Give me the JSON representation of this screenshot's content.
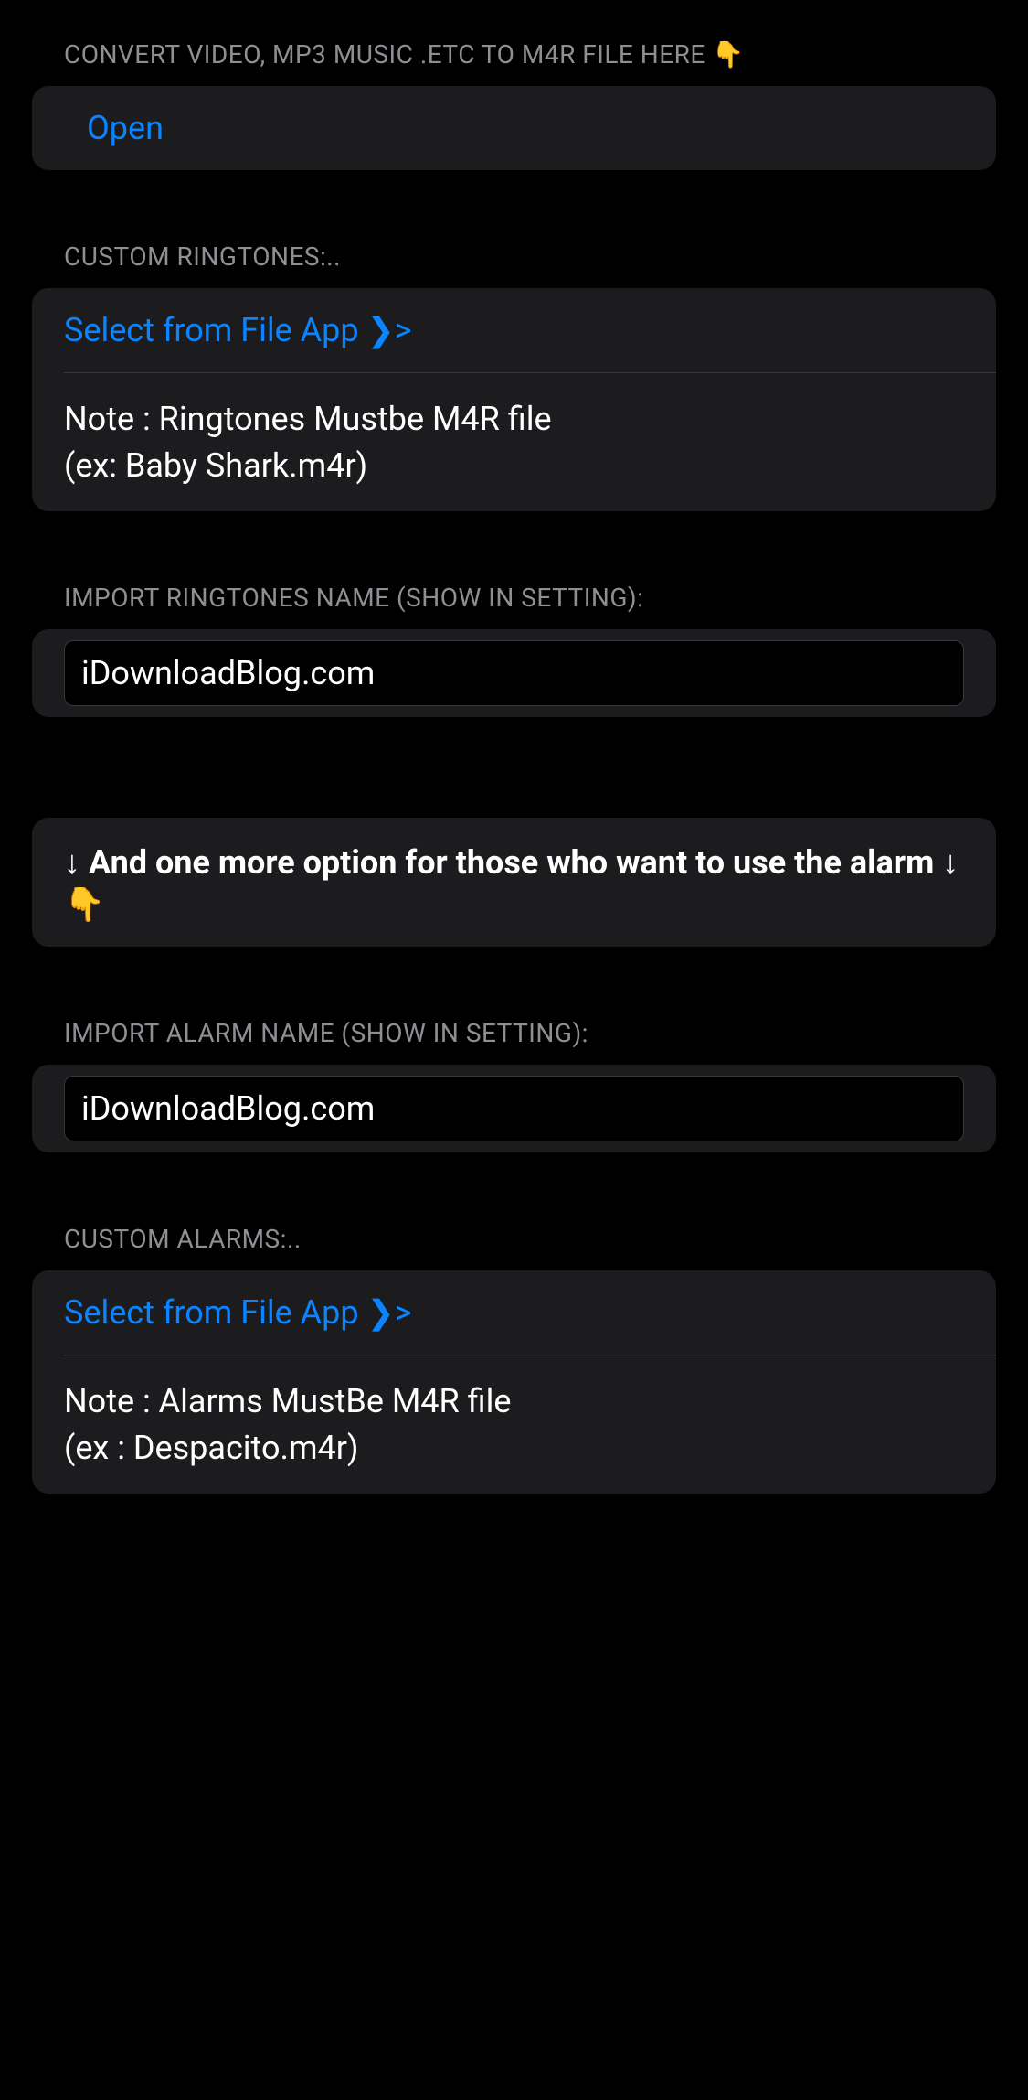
{
  "sections": {
    "convert": {
      "header": "CONVERT VIDEO, MP3 MUSIC .ETC TO M4R FILE HERE  👇",
      "open_label": "Open"
    },
    "custom_ringtones": {
      "header": "CUSTOM RINGTONES:..",
      "select_label": "Select from File App ❯>",
      "note_line1": "Note : Ringtones Mustbe M4R file",
      "note_line2": "(ex: Baby Shark.m4r)"
    },
    "import_ringtone_name": {
      "header": "IMPORT RINGTONES NAME (SHOW IN SETTING):",
      "value": "iDownloadBlog.com"
    },
    "alarm_info": {
      "text": "↓ And one more option for those who want to use the alarm ↓",
      "emoji": "👇"
    },
    "import_alarm_name": {
      "header": "IMPORT ALARM NAME (SHOW IN SETTING):",
      "value": "iDownloadBlog.com"
    },
    "custom_alarms": {
      "header": "CUSTOM ALARMS:..",
      "select_label": "Select from File App ❯>",
      "note_line1": "Note : Alarms MustBe M4R file",
      "note_line2": "(ex : Despacito.m4r)"
    }
  }
}
